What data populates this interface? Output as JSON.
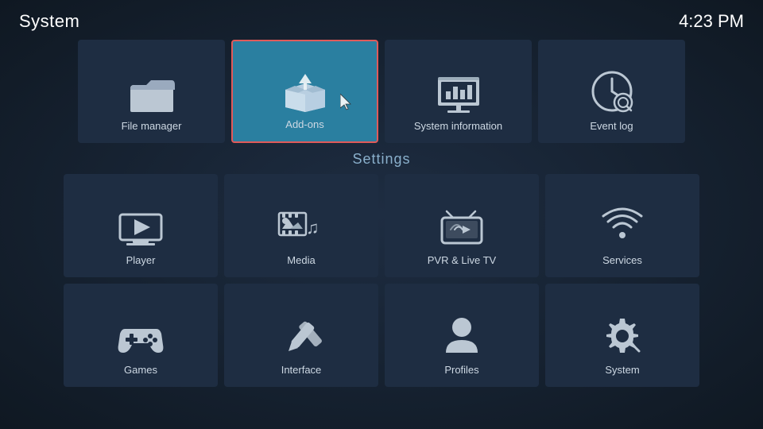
{
  "header": {
    "title": "System",
    "time": "4:23 PM"
  },
  "top_row": [
    {
      "id": "file-manager",
      "label": "File manager",
      "active": false
    },
    {
      "id": "add-ons",
      "label": "Add-ons",
      "active": true
    },
    {
      "id": "system-information",
      "label": "System information",
      "active": false
    },
    {
      "id": "event-log",
      "label": "Event log",
      "active": false
    }
  ],
  "section_label": "Settings",
  "settings_tiles": [
    {
      "id": "player",
      "label": "Player"
    },
    {
      "id": "media",
      "label": "Media"
    },
    {
      "id": "pvr-live-tv",
      "label": "PVR & Live TV"
    },
    {
      "id": "services",
      "label": "Services"
    },
    {
      "id": "games",
      "label": "Games"
    },
    {
      "id": "interface",
      "label": "Interface"
    },
    {
      "id": "profiles",
      "label": "Profiles"
    },
    {
      "id": "system",
      "label": "System"
    }
  ]
}
